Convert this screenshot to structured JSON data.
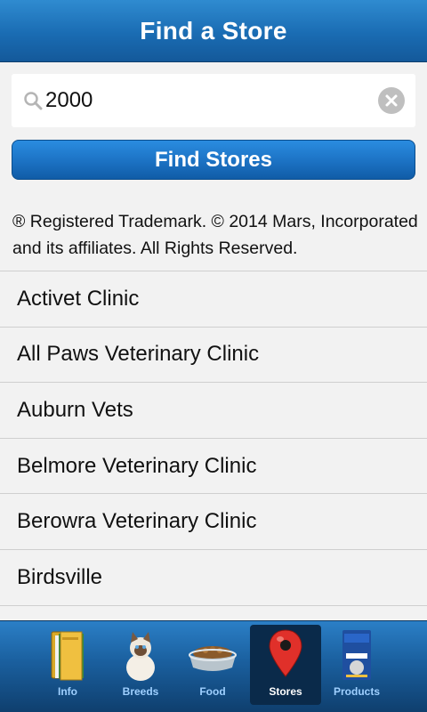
{
  "header": {
    "title": "Find a Store"
  },
  "search": {
    "value": "2000",
    "placeholder": ""
  },
  "find_button": {
    "label": "Find Stores"
  },
  "trademark": {
    "text": "® Registered Trademark. © 2014 Mars, Incorporated and its affiliates. All Rights Reserved."
  },
  "stores": [
    {
      "name": "Activet Clinic"
    },
    {
      "name": "All Paws Veterinary Clinic"
    },
    {
      "name": "Auburn Vets"
    },
    {
      "name": "Belmore Veterinary Clinic"
    },
    {
      "name": "Berowra Veterinary Clinic"
    },
    {
      "name": "Birdsville"
    }
  ],
  "tabs": [
    {
      "label": "Info",
      "icon": "folder-icon"
    },
    {
      "label": "Breeds",
      "icon": "cat-icon"
    },
    {
      "label": "Food",
      "icon": "food-bowl-icon"
    },
    {
      "label": "Stores",
      "icon": "map-pin-icon",
      "active": true
    },
    {
      "label": "Products",
      "icon": "product-bag-icon"
    }
  ],
  "colors": {
    "header_blue": "#1a6cb3",
    "button_blue": "#1d74c6",
    "tab_active": "#0a2a4a",
    "tab_label": "#9fd0ff"
  }
}
